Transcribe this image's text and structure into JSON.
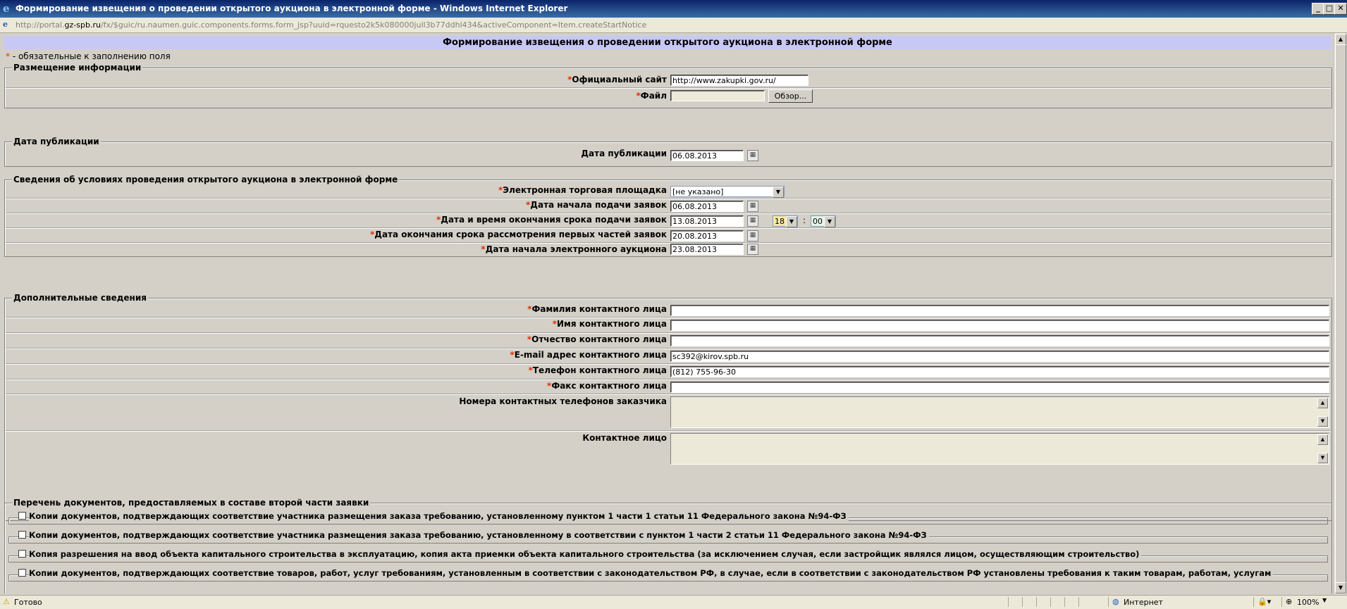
{
  "window": {
    "title": "Формирование извещения о проведении открытого аукциона в электронной форме - Windows Internet Explorer",
    "icon": "ie-icon"
  },
  "address": {
    "prefix": "http://portal.",
    "domain": "gz-spb.ru",
    "path": "/fx/$guic/ru.naumen.guic.components.forms.form_jsp?uuid=rquesto2k5k080000jull3b77ddhl434&activeComponent=Item.createStartNotice"
  },
  "form": {
    "title": "Формирование извещения о проведении открытого аукциона в электронной форме",
    "required_mark": "*",
    "required_note": " - обязательные к заполнению поля"
  },
  "placement": {
    "legend": "Размещение информации",
    "site_label": "Официальный сайт",
    "site_value": "http://www.zakupki.gov.ru/",
    "file_label": "Файл",
    "browse_label": "Обзор..."
  },
  "publication": {
    "legend": "Дата публикации",
    "date_label": "Дата публикации",
    "date_value": "06.08.2013"
  },
  "conditions": {
    "legend": "Сведения об условиях проведения открытого аукциона в электронной форме",
    "platform_label": "Электронная торговая площадка",
    "platform_value": "[не указано]",
    "start_label": "Дата начала подачи заявок",
    "start_value": "06.08.2013",
    "end_label": "Дата и время окончания срока подачи заявок",
    "end_value": "13.08.2013",
    "end_hour": "18",
    "end_minute": "00",
    "time_sep": ":",
    "review_label": "Дата окончания срока рассмотрения первых частей заявок",
    "review_value": "20.08.2013",
    "auction_label": "Дата начала электронного аукциона",
    "auction_value": "23.08.2013"
  },
  "additional": {
    "legend": "Дополнительные сведения",
    "last_name_label": "Фамилия контактного лица",
    "last_name_value": "",
    "first_name_label": "Имя контактного лица",
    "first_name_value": "",
    "middle_name_label": "Отчество контактного лица",
    "middle_name_value": "",
    "email_label": "E-mail адрес контактного лица",
    "email_value": "sc392@kirov.spb.ru",
    "phone_label": "Телефон контактного лица",
    "phone_value": "(812) 755-96-30",
    "fax_label": "Факс контактного лица",
    "fax_value": "",
    "customer_phones_label": "Номера контактных телефонов заказчика",
    "contact_person_label": "Контактное лицо"
  },
  "documents": {
    "legend": "Перечень документов, предоставляемых в составе второй части заявки",
    "items": [
      "Копии документов, подтверждающих соответствие участника размещения заказа требованию, установленному пунктом 1 части 1 статьи 11 Федерального закона №94-ФЗ",
      "Копии документов, подтверждающих соответствие участника размещения заказа требованию, установленному в соответствии с пунктом 1 части 2 статьи 11 Федерального закона №94-ФЗ",
      "Копия разрешения на ввод объекта капитального строительства в эксплуатацию, копия акта приемки объекта капитального строительства (за исключением случая, если застройщик являлся лицом, осуществляющим строительство)",
      "Копии документов, подтверждающих соответствие товаров, работ, услуг требованиям, установленным в соответствии с законодательством РФ, в случае, если в соответствии с законодательством РФ установлены требования к таким товарам, работам, услугам"
    ]
  },
  "status": {
    "text": "Готово",
    "zone": "Интернет",
    "zoom": "100%"
  }
}
